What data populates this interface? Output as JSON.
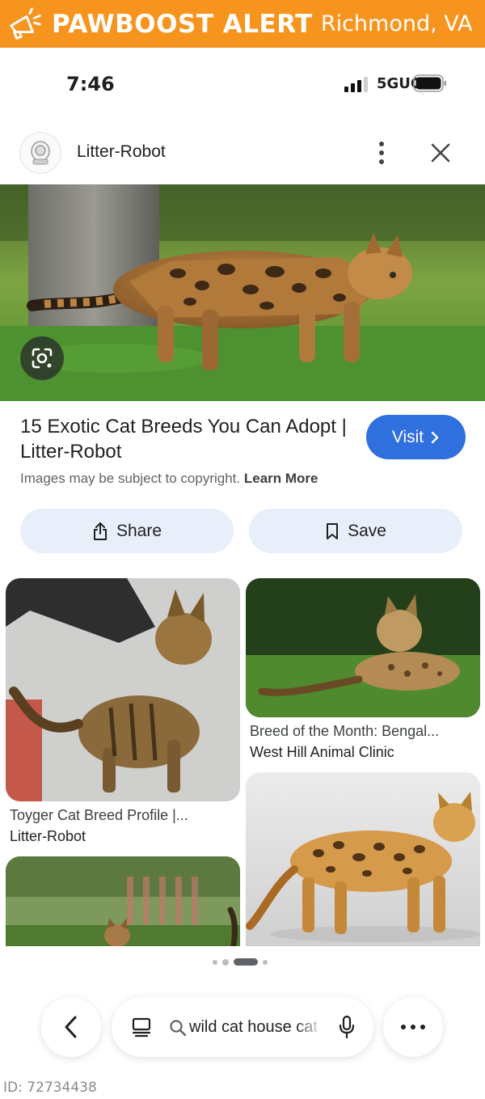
{
  "banner": {
    "brand": "PAWBOOST ALERT",
    "city": "Richmond, VA",
    "color": "#f7941d",
    "icon": "megaphone-icon"
  },
  "status": {
    "time": "7:46",
    "network": "5GUC"
  },
  "source": {
    "name": "Litter-Robot"
  },
  "result": {
    "title": "15 Exotic Cat Breeds You Can Adopt | Litter-Robot",
    "visit_label": "Visit",
    "copyright_text": "Images may be subject to copyright.",
    "learn_more": "Learn More"
  },
  "actions": {
    "share_label": "Share",
    "save_label": "Save"
  },
  "related": [
    {
      "title": "Toyger Cat Breed Profile |...",
      "source": "Litter-Robot"
    },
    {
      "title": "Breed of the Month: Bengal...",
      "source": "West Hill Animal Clinic"
    },
    {
      "title": "",
      "source": ""
    },
    {
      "title": "",
      "source": ""
    }
  ],
  "search": {
    "query": "wild cat house cat"
  },
  "footer": {
    "id_text": "ID: 72734438"
  },
  "colors": {
    "accent": "#2f6fde",
    "pill_bg": "#e8effb"
  }
}
